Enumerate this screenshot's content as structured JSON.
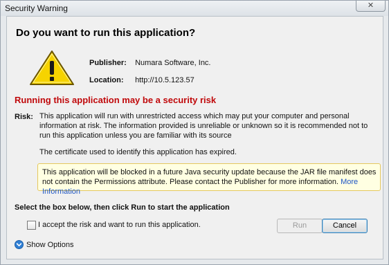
{
  "window": {
    "title": "Security Warning"
  },
  "dialog": {
    "question": "Do you want to run this application?",
    "publisher_label": "Publisher:",
    "publisher_value": "Numara Software, Inc.",
    "location_label": "Location:",
    "location_value": "http://10.5.123.57",
    "risk_heading": "Running this application may be a security risk",
    "risk_label": "Risk:",
    "risk_text": "This application will run with unrestricted access which may put your computer and personal information at risk. The information provided is unreliable or unknown so it is recommended not to run this application unless you are familiar with its source",
    "cert_text": "The certificate used to identify this application has expired.",
    "notice_text": "This application will be blocked in a future Java security update because the JAR file manifest does not contain the Permissions attribute. Please contact the Publisher for more information.",
    "notice_link": "More Information",
    "instruction": "Select the box below, then click Run to start the application",
    "accept_label": "I accept the risk and want to run this application.",
    "accept_checked": false,
    "run_label": "Run",
    "cancel_label": "Cancel",
    "show_options_label": "Show Options"
  },
  "colors": {
    "risk_red": "#c0090b",
    "link_blue": "#1d55c4",
    "notice_bg": "#ffffe2",
    "warning_yellow": "#f6d300"
  },
  "icons": {
    "warning": "warning-triangle-icon",
    "close": "close-icon",
    "show_options": "chevron-down-circle-icon"
  }
}
